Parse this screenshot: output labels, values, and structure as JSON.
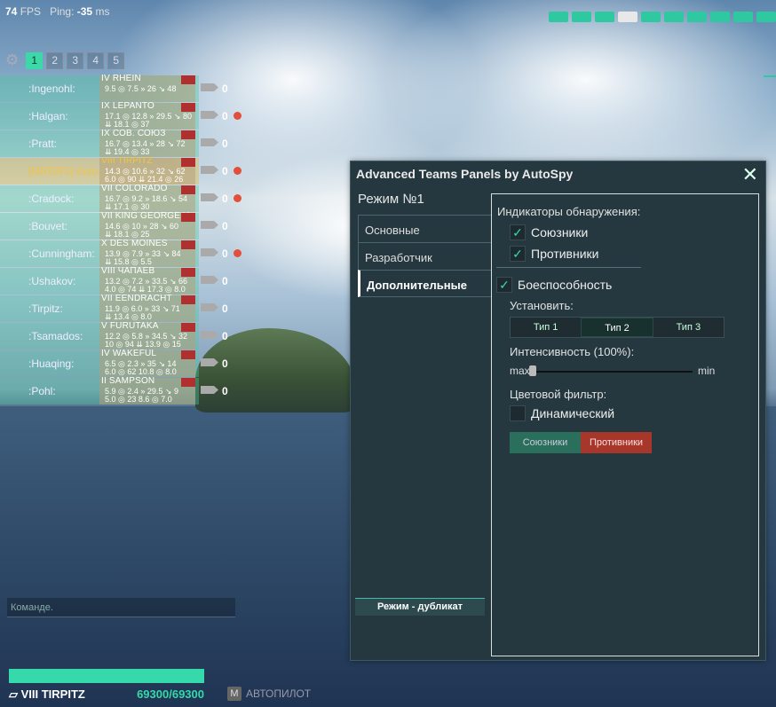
{
  "hud": {
    "fps": "74",
    "fps_label": "FPS",
    "ping_label": "Ping:",
    "ping": "-35",
    "ping_unit": "ms"
  },
  "tabs": [
    "1",
    "2",
    "3",
    "4",
    "5"
  ],
  "team": [
    {
      "name": ":Ingenohl:",
      "ship": "IV RHEIN",
      "s1": "9.5 ◎ 7.5 » 26 ↘ 48",
      "s2": "",
      "frags": "0",
      "dot": false,
      "self": false
    },
    {
      "name": ":Halgan:",
      "ship": "IX LEPANTO",
      "s1": "17.1 ◎ 12.8 » 29.5 ↘ 80",
      "s2": "⇊ 18.1 ◎ 37",
      "frags": "0",
      "dot": true,
      "self": false
    },
    {
      "name": ":Pratt:",
      "ship": "IX СОВ. СОЮЗ",
      "s1": "16.7 ◎ 13.4 » 28 ↘ 72",
      "s2": "⇊ 19.4 ◎ 33",
      "frags": "0",
      "dot": false,
      "self": false
    },
    {
      "name": "[MRDRS] Auto...",
      "ship": "VIII TIRPITZ",
      "s1": "14.3 ◎ 10.6 » 32 ↘ 62",
      "s2": "6.0 ◎ 90 ⇊ 21.4 ◎ 26",
      "frags": "0",
      "dot": true,
      "self": true
    },
    {
      "name": ":Cradock:",
      "ship": "VII COLORADO",
      "s1": "16.7 ◎ 9.2 » 18.6 ↘ 54",
      "s2": "⇊ 17.1 ◎ 30",
      "frags": "0",
      "dot": true,
      "self": false
    },
    {
      "name": ":Bouvet:",
      "ship": "VII KING GEORGE V",
      "s1": "14.6 ◎ 10 » 28 ↘ 60",
      "s2": "⇊ 18.1 ◎ 25",
      "frags": "0",
      "dot": false,
      "self": false
    },
    {
      "name": ":Cunningham:",
      "ship": "X DES MOINES",
      "s1": "13.9 ◎ 7.9 » 33 ↘ 84",
      "s2": "⇊ 15.8 ◎ 5.5",
      "frags": "0",
      "dot": true,
      "self": false
    },
    {
      "name": ":Ushakov:",
      "ship": "VIII ЧАПАЕВ",
      "s1": "13.2 ◎ 7.2 » 33.5 ↘ 66",
      "s2": "4.0 ◎ 74 ⇊ 17.3 ◎ 8.0",
      "frags": "0",
      "dot": false,
      "self": false
    },
    {
      "name": ":Tirpitz:",
      "ship": "VII EENDRACHT",
      "s1": "11.9 ◎ 6.0 » 33 ↘ 71",
      "s2": "⇊ 13.4 ◎ 8.0",
      "frags": "0",
      "dot": false,
      "self": false
    },
    {
      "name": ":Tsamados:",
      "ship": "V FURUTAKA",
      "s1": "12.2 ◎ 5.8 » 34.5 ↘ 32",
      "s2": "10 ◎ 94 ⇊ 13.9 ◎ 15",
      "frags": "0",
      "dot": false,
      "self": false
    },
    {
      "name": ":Huaqing:",
      "ship": "IV WAKEFUL",
      "s1": "6.5 ◎ 2.3 » 35 ↘ 14",
      "s2": "6.0 ◎ 62 10.8 ◎ 8.0",
      "frags": "0",
      "dot": false,
      "self": false
    },
    {
      "name": ":Pohl:",
      "ship": "II SAMPSON",
      "s1": "5.9 ◎ 2.4 » 29.5 ↘ 9",
      "s2": "5.0 ◎ 23 8.6 ◎ 7.0",
      "frags": "0",
      "dot": false,
      "self": false
    }
  ],
  "chat": {
    "placeholder": "Команде."
  },
  "player": {
    "ship": "VIII TIRPITZ",
    "hp": "69300/69300",
    "hp_fraction": 1.0
  },
  "autopilot": {
    "key": "M",
    "label": "АВТОПИЛОТ"
  },
  "window": {
    "title": "Advanced Teams Panels by AutoSpy",
    "mode": "Режим №1",
    "nav": [
      "Основные",
      "Разработчик",
      "Дополнительные"
    ],
    "active_nav": 2,
    "duplicate_button": "Режим - дубликат",
    "content": {
      "detect_label": "Индикаторы обнаружения:",
      "allies": "Союзники",
      "enemies": "Противники",
      "combat": "Боеспособность",
      "set_label": "Установить:",
      "types": [
        "Тип 1",
        "Тип 2",
        "Тип 3"
      ],
      "active_type": 1,
      "intensity_label": "Интенсивность (100%):",
      "max": "max",
      "min": "min",
      "filter_label": "Цветовой фильтр:",
      "dynamic": "Динамический",
      "filter_allies": "Союзники",
      "filter_enemies": "Противники"
    }
  },
  "colors": {
    "accent": "#35d9aa",
    "enemy": "#a7372a",
    "ally": "#2a6e5c"
  }
}
